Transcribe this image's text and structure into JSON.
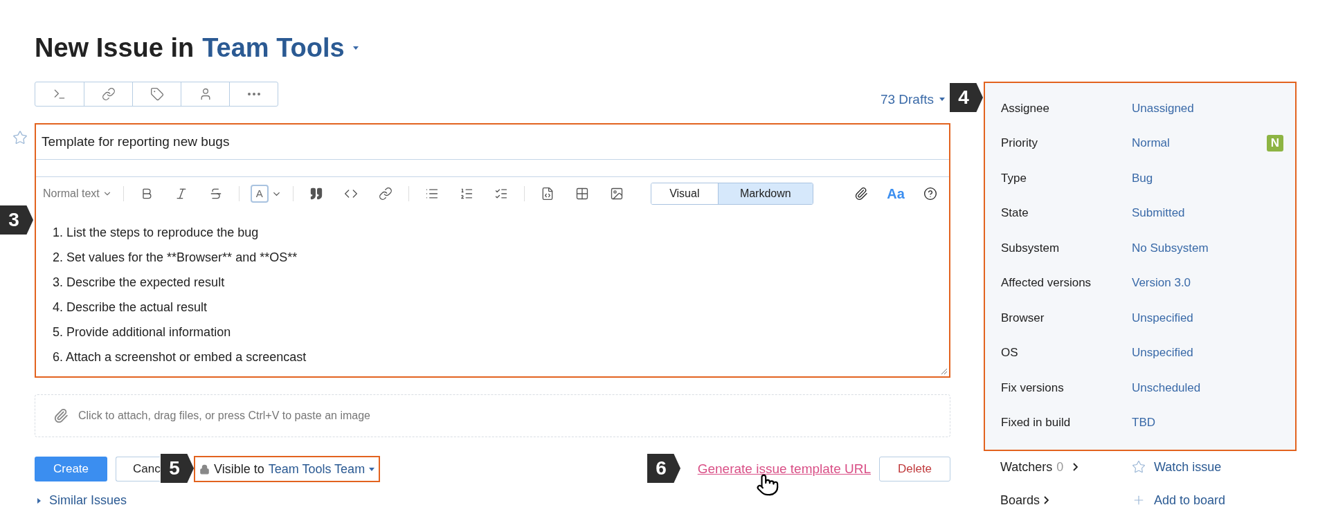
{
  "title": {
    "prefix": "New Issue in",
    "project": "Team Tools"
  },
  "drafts": "73 Drafts",
  "summary": "Template for reporting new bugs",
  "editor": {
    "text_style": "Normal text",
    "font_color": "A",
    "modes": [
      {
        "label": "Visual",
        "selected": false
      },
      {
        "label": "Markdown",
        "selected": true
      }
    ],
    "font_button": "Aa",
    "lines": [
      "1. List the steps to reproduce the bug",
      "2. Set values for the **Browser** and **OS**",
      "3. Describe the expected result",
      "4. Describe the actual result",
      "5. Provide additional information",
      "6. Attach a screenshot or embed a screencast"
    ]
  },
  "attach_hint": "Click to attach, drag files, or press Ctrl+V to paste an image",
  "buttons": {
    "create": "Create",
    "cancel": "Canc",
    "delete": "Delete"
  },
  "visibility": {
    "prefix": "Visible to",
    "group": "Team Tools Team"
  },
  "template_link": "Generate issue template URL",
  "similar": "Similar Issues",
  "fields": [
    {
      "label": "Assignee",
      "value": "Unassigned"
    },
    {
      "label": "Priority",
      "value": "Normal",
      "badge": "N",
      "color": "#8db443"
    },
    {
      "label": "Type",
      "value": "Bug"
    },
    {
      "label": "State",
      "value": "Submitted"
    },
    {
      "label": "Subsystem",
      "value": "No Subsystem"
    },
    {
      "label": "Affected versions",
      "value": "Version 3.0"
    },
    {
      "label": "Browser",
      "value": "Unspecified"
    },
    {
      "label": "OS",
      "value": "Unspecified"
    },
    {
      "label": "Fix versions",
      "value": "Unscheduled"
    },
    {
      "label": "Fixed in build",
      "value": "TBD"
    }
  ],
  "watchers": {
    "label": "Watchers",
    "count": "0",
    "action": "Watch issue"
  },
  "boards": {
    "label": "Boards",
    "action": "Add to board"
  },
  "callouts": [
    "3",
    "4",
    "5",
    "6"
  ]
}
